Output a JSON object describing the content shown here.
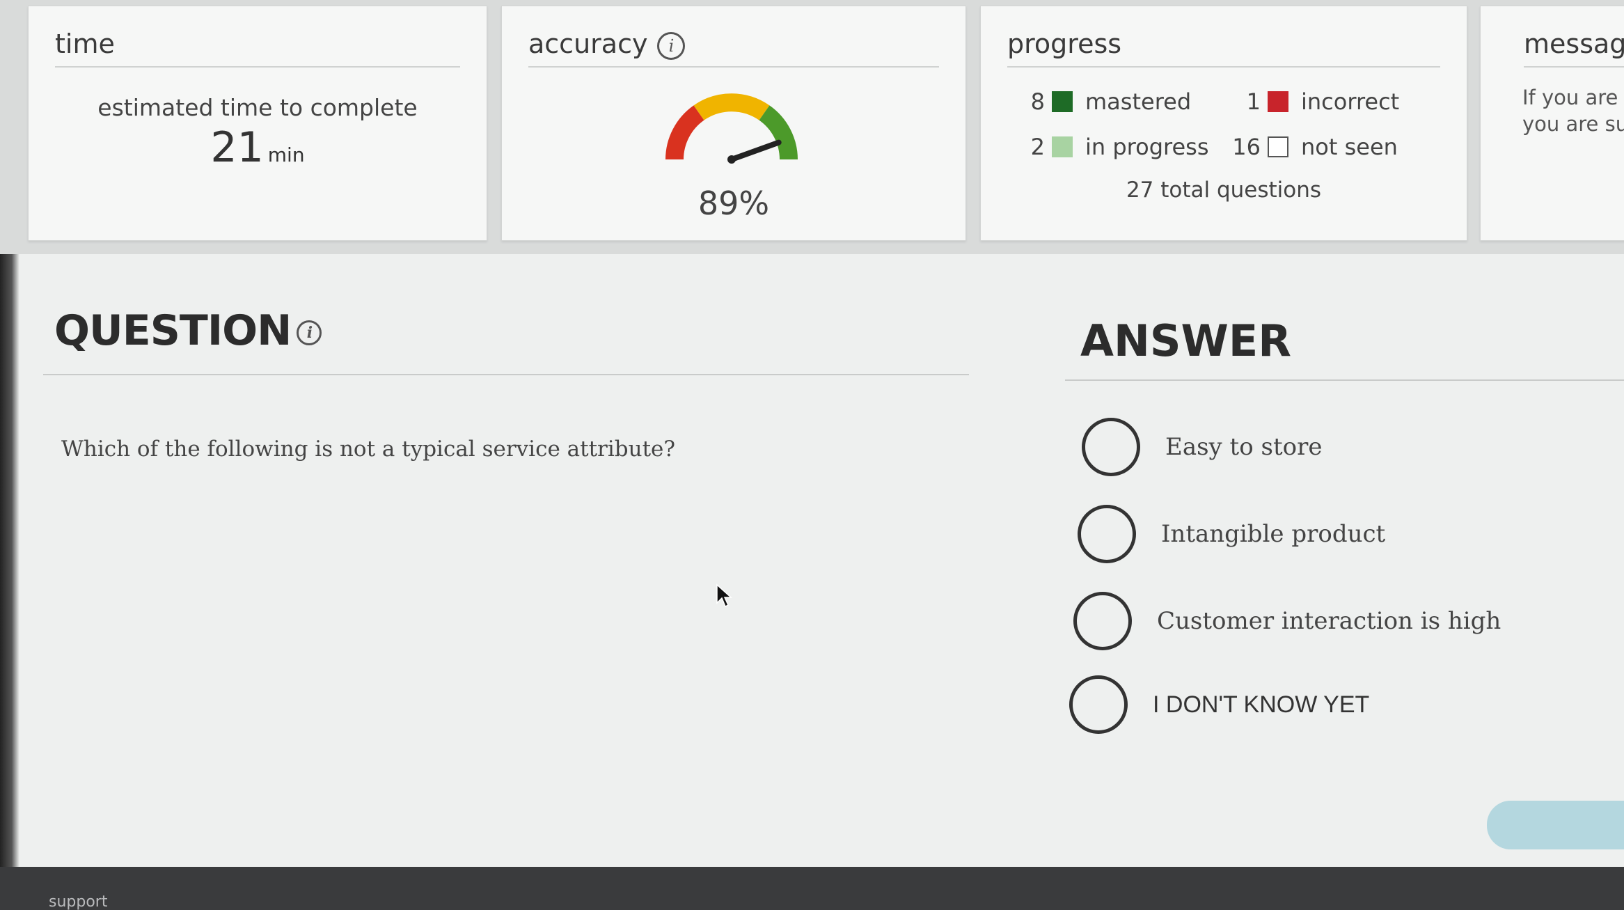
{
  "cards": {
    "time": {
      "title": "time",
      "caption": "estimated time to complete",
      "value": "21",
      "unit": "min"
    },
    "accuracy": {
      "title": "accuracy",
      "value": "89%",
      "gauge_fraction": 0.89
    },
    "progress": {
      "title": "progress",
      "items": [
        {
          "count": "8",
          "label": "mastered",
          "color": "#1e6b26"
        },
        {
          "count": "1",
          "label": "incorrect",
          "color": "#c8242b"
        },
        {
          "count": "2",
          "label": "in progress",
          "color": "#a8d3a2"
        },
        {
          "count": "16",
          "label": "not seen",
          "color": "#ffffff"
        }
      ],
      "total": "27 total questions"
    },
    "message": {
      "title": "message",
      "line1": "If you are u",
      "line2": "you are sur"
    }
  },
  "question": {
    "heading": "QUESTION",
    "text": "Which of the following is not a typical service attribute?"
  },
  "answer": {
    "heading": "ANSWER",
    "options": [
      {
        "label": "Easy to store"
      },
      {
        "label": "Intangible product"
      },
      {
        "label": "Customer interaction is high"
      },
      {
        "label": "I DON'T KNOW YET"
      }
    ]
  },
  "footer": {
    "support": "support"
  },
  "colors": {
    "gauge_red": "#d9321f",
    "gauge_yellow": "#f0b400",
    "gauge_green": "#4c9a2a",
    "button": "#b4d7df"
  }
}
